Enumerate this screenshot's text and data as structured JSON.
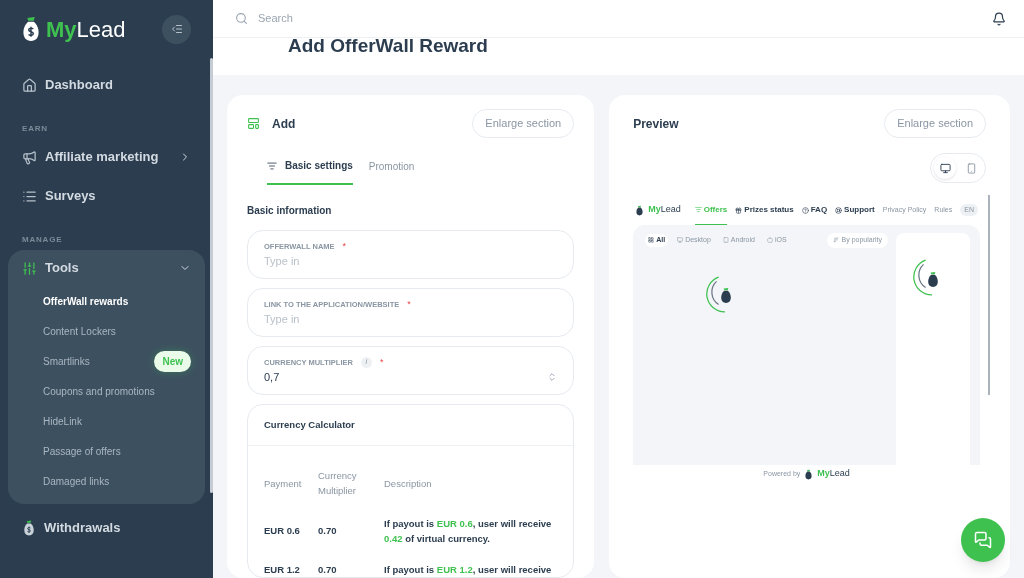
{
  "sidebar": {
    "logo": {
      "first": "My",
      "second": "Lead"
    },
    "sections": [
      {
        "items": [
          {
            "label": "Dashboard",
            "expanded": false
          }
        ]
      },
      {
        "heading": "EARN",
        "items": [
          {
            "label": "Affiliate marketing",
            "has_children": true,
            "expanded": false
          },
          {
            "label": "Surveys",
            "expanded": false
          }
        ]
      },
      {
        "heading": "MANAGE",
        "items": [
          {
            "label": "Tools",
            "has_children": true,
            "expanded": true,
            "children": [
              {
                "label": "OfferWall rewards",
                "selected": true
              },
              {
                "label": "Content Lockers",
                "selected": false
              },
              {
                "label": "Smartlinks",
                "selected": false,
                "badge": "New"
              },
              {
                "label": "Coupons and promotions",
                "selected": false
              },
              {
                "label": "HideLink",
                "selected": false
              },
              {
                "label": "Passage of offers",
                "selected": false
              },
              {
                "label": "Damaged links",
                "selected": false
              }
            ]
          },
          {
            "label": "Withdrawals",
            "expanded": false
          }
        ]
      }
    ]
  },
  "search": {
    "placeholder": "Search"
  },
  "page_title": "Add OfferWall Reward",
  "add_panel": {
    "title": "Add",
    "enlarge": "Enlarge section",
    "tabs": [
      {
        "label": "Basic settings",
        "selected": true
      },
      {
        "label": "Promotion",
        "selected": false
      }
    ],
    "section_title": "Basic information",
    "fields": [
      {
        "label": "OFFERWALL NAME",
        "required_mark": "*",
        "placeholder": "Type in",
        "kind": "text"
      },
      {
        "label": "LINK TO THE APPLICATION/WEBSITE",
        "required_mark": "*",
        "placeholder": "Type in",
        "kind": "text"
      },
      {
        "label": "CURRENCY MULTIPLIER",
        "required_mark": "*",
        "info": "i",
        "value": "0,7",
        "kind": "number"
      }
    ],
    "calculator": {
      "title": "Currency Calculator",
      "columns": [
        "Payment",
        "Currency Multiplier",
        "Description"
      ],
      "rows": [
        {
          "payment": "EUR 0.6",
          "multiplier": "0.70",
          "description": {
            "before": "If payout is",
            "payout": "EUR 0.6",
            "middle": ", user will receive",
            "amount": "0.42",
            "after": "of virtual currency."
          }
        },
        {
          "payment": "EUR 1.2",
          "multiplier": "0.70",
          "description": {
            "before": "If payout is",
            "payout": "EUR 1.2",
            "middle": ", user will receive"
          }
        }
      ]
    }
  },
  "preview_panel": {
    "title": "Preview",
    "enlarge": "Enlarge section",
    "devices": [
      {
        "kind": "desktop",
        "selected": true
      },
      {
        "kind": "mobile",
        "selected": false
      }
    ],
    "site": {
      "logo": {
        "first": "My",
        "second": "Lead"
      },
      "nav": [
        {
          "label": "Offers",
          "selected": true
        },
        {
          "label": "Prizes status",
          "selected": false
        },
        {
          "label": "FAQ",
          "selected": false
        },
        {
          "label": "Support",
          "selected": false
        }
      ],
      "links": [
        "Privacy Policy",
        "Rules"
      ],
      "language": "EN",
      "filters": [
        {
          "label": "All",
          "selected": true
        },
        {
          "label": "Desktop",
          "selected": false
        },
        {
          "label": "Android",
          "selected": false
        },
        {
          "label": "iOS",
          "selected": false
        }
      ],
      "sort": "By popularity",
      "powered_by": "Powered by",
      "footer_logo": {
        "first": "My",
        "second": "Lead"
      }
    }
  }
}
